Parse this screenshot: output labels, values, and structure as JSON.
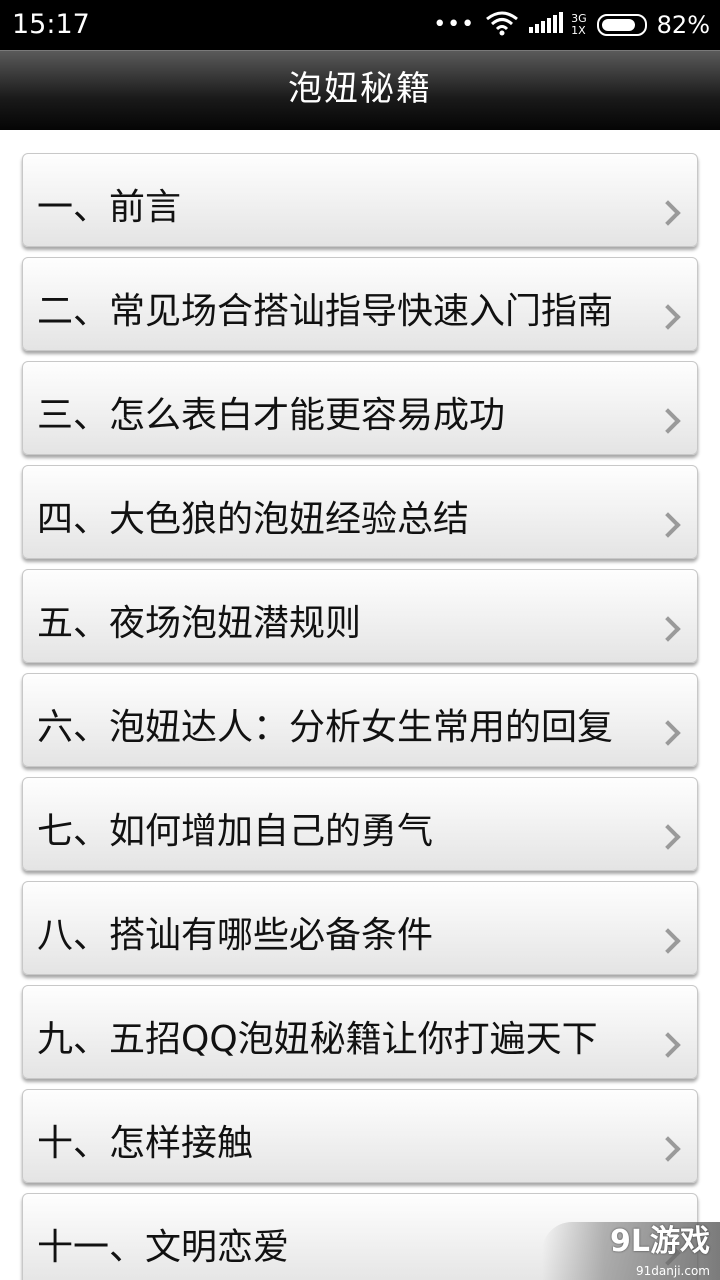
{
  "status_bar": {
    "time": "15:17",
    "more_dots": "•••",
    "network_top": "3G",
    "network_bottom": "1X",
    "battery_percent": "82%",
    "battery_level": 0.82,
    "icons": [
      "wifi-icon",
      "signal-icon",
      "battery-icon"
    ]
  },
  "header": {
    "title": "泡妞秘籍"
  },
  "list": {
    "items": [
      {
        "label": "一、前言"
      },
      {
        "label": "二、常见场合搭讪指导快速入门指南"
      },
      {
        "label": "三、怎么表白才能更容易成功"
      },
      {
        "label": "四、大色狼的泡妞经验总结"
      },
      {
        "label": "五、夜场泡妞潜规则"
      },
      {
        "label": "六、泡妞达人：分析女生常用的回复"
      },
      {
        "label": "七、如何增加自己的勇气"
      },
      {
        "label": "八、搭讪有哪些必备条件"
      },
      {
        "label": "九、五招QQ泡妞秘籍让你打遍天下"
      },
      {
        "label": "十、怎样接触"
      },
      {
        "label": "十一、文明恋爱"
      }
    ]
  },
  "watermark": {
    "logo": "9L游戏",
    "url": "91danji.com"
  },
  "colors": {
    "status_bar_bg": "#000000",
    "title_text": "#ffffff",
    "item_text": "#111111",
    "chevron": "#9a9a9a"
  }
}
